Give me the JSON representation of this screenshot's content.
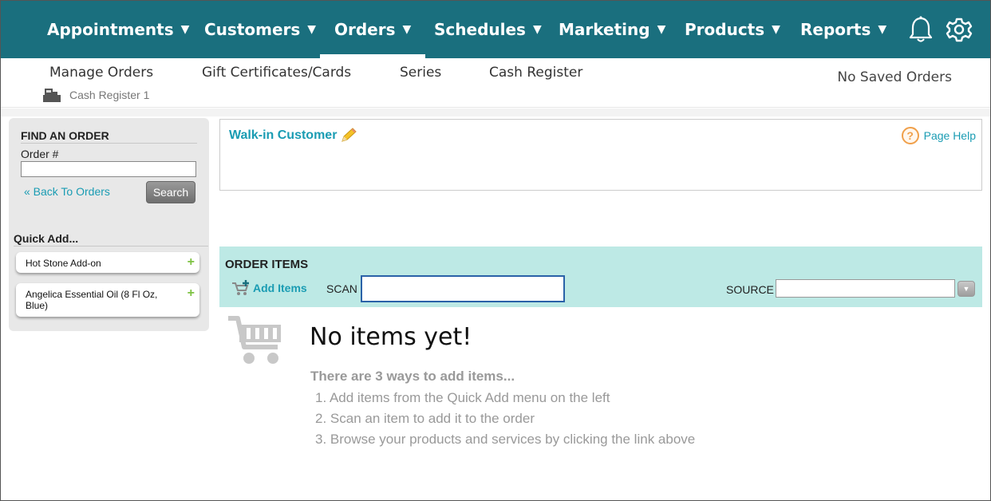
{
  "nav": {
    "items": [
      {
        "label": "Appointments"
      },
      {
        "label": "Customers"
      },
      {
        "label": "Orders"
      },
      {
        "label": "Schedules"
      },
      {
        "label": "Marketing"
      },
      {
        "label": "Products"
      },
      {
        "label": "Reports"
      }
    ],
    "caret": "▼",
    "active": "Orders"
  },
  "subnav": {
    "items": [
      "Manage Orders",
      "Gift Certificates/Cards",
      "Series",
      "Cash Register"
    ],
    "register": "Cash Register 1",
    "saved_orders": "No Saved Orders"
  },
  "find_order": {
    "title": "FIND AN ORDER",
    "order_label": "Order #",
    "order_value": "",
    "back_link": "«  Back To Orders",
    "search_label": "Search"
  },
  "quick_add": {
    "title": "Quick Add...",
    "items": [
      "Hot Stone Add-on",
      "Angelica Essential Oil (8 Fl Oz, Blue)"
    ],
    "plus": "+"
  },
  "customer": {
    "name": "Walk-in Customer",
    "page_help": "Page Help",
    "help_glyph": "?"
  },
  "order_items": {
    "title": "ORDER ITEMS",
    "add_items": "Add Items",
    "scan_label": "SCAN",
    "scan_value": "",
    "source_label": "SOURCE",
    "source_value": "",
    "dropdown_glyph": "▼"
  },
  "empty_state": {
    "title": "No items yet!",
    "ways_title": "There are 3 ways to add items...",
    "ways": [
      "1.  Add items from the Quick Add menu on the left",
      "2.  Scan an item to add it to the order",
      "3.  Browse your products and services by clicking the link above"
    ]
  },
  "colors": {
    "nav_bg": "#1a6f7e",
    "link": "#1a9cb3",
    "items_bar": "#bde9e5",
    "plus_green": "#7dc242",
    "help_orange": "#f0a04b"
  }
}
